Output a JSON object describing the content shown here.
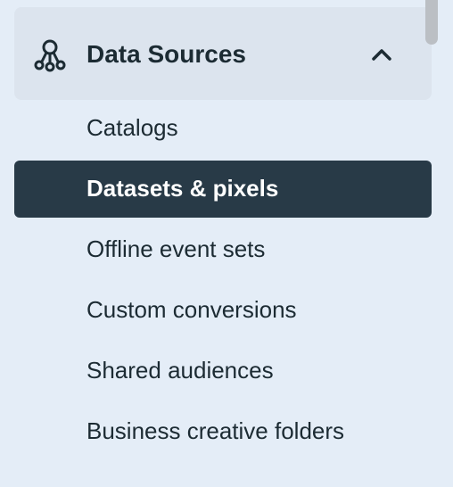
{
  "section": {
    "title": "Data Sources",
    "icon": "data-sources-icon",
    "expanded": true,
    "toggle_icon": "chevron-up-icon"
  },
  "items": [
    {
      "label": "Catalogs",
      "active": false
    },
    {
      "label": "Datasets & pixels",
      "active": true
    },
    {
      "label": "Offline event sets",
      "active": false
    },
    {
      "label": "Custom conversions",
      "active": false
    },
    {
      "label": "Shared audiences",
      "active": false
    },
    {
      "label": "Business creative folders",
      "active": false
    }
  ],
  "colors": {
    "background": "#e4edf7",
    "header_background": "#dce4ee",
    "active_background": "#283a47",
    "text": "#1c2b33",
    "active_text": "#ffffff"
  }
}
